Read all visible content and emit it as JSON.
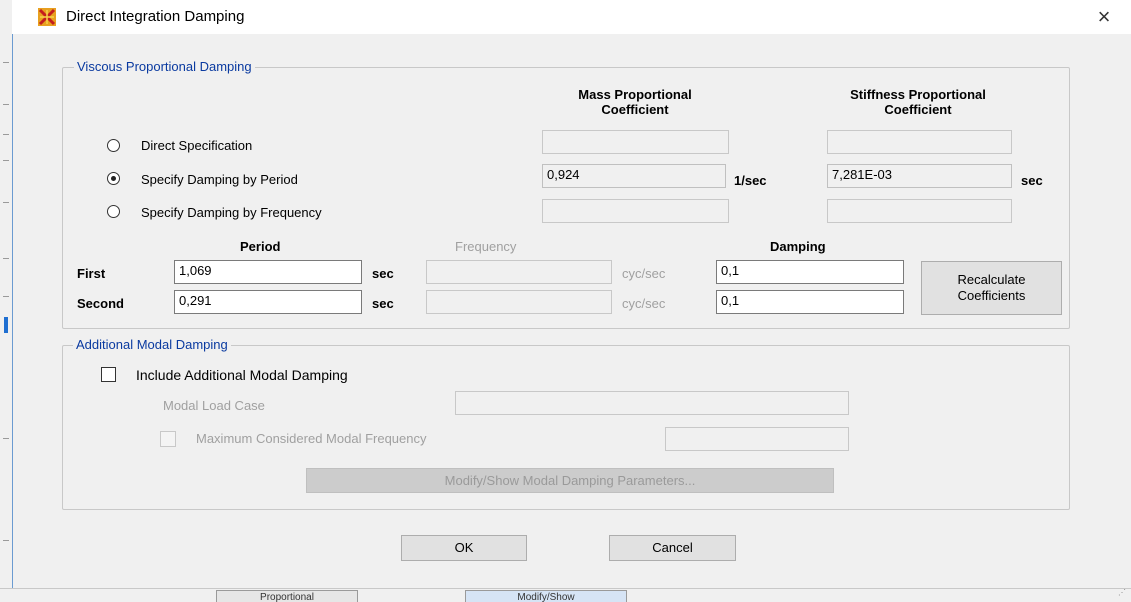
{
  "dialog": {
    "title": "Direct Integration Damping",
    "close": "×"
  },
  "viscous": {
    "legend": "Viscous Proportional Damping",
    "mass_header": "Mass Proportional\nCoefficient",
    "stiffness_header": "Stiffness Proportional\nCoefficient",
    "options": [
      {
        "label": "Direct Specification",
        "selected": false
      },
      {
        "label": "Specify Damping by Period",
        "selected": true
      },
      {
        "label": "Specify Damping by Frequency",
        "selected": false
      }
    ],
    "mass_value": "0,924",
    "mass_unit": "1/sec",
    "stiffness_value": "7,281E-03",
    "stiffness_unit": "sec",
    "period_header": "Period",
    "frequency_header": "Frequency",
    "damping_header": "Damping",
    "rows": [
      {
        "label": "First",
        "period": "1,069",
        "period_unit": "sec",
        "freq_unit": "cyc/sec",
        "damping": "0,1"
      },
      {
        "label": "Second",
        "period": "0,291",
        "period_unit": "sec",
        "freq_unit": "cyc/sec",
        "damping": "0,1"
      }
    ],
    "recalc_label": "Recalculate\nCoefficients"
  },
  "modal": {
    "legend": "Additional Modal Damping",
    "include_label": "Include Additional Modal Damping",
    "load_case_label": "Modal Load Case",
    "max_freq_label": "Maximum Considered Modal Frequency",
    "modify_label": "Modify/Show Modal Damping Parameters..."
  },
  "buttons": {
    "ok": "OK",
    "cancel": "Cancel"
  },
  "background": {
    "tab_left": "Proportional",
    "tab_right": "Modify/Show"
  }
}
